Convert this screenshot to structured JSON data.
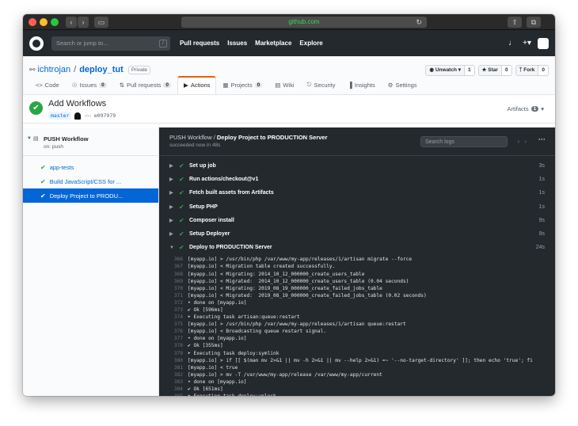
{
  "browser": {
    "url": "github.com",
    "reload_icon": "reload-icon"
  },
  "header": {
    "search_placeholder": "Search or jump to...",
    "search_shortcut": "/",
    "nav": [
      "Pull requests",
      "Issues",
      "Marketplace",
      "Explore"
    ],
    "icons": [
      "bell-icon",
      "plus-icon",
      "avatar-icon"
    ]
  },
  "repo": {
    "owner": "ichtrojan",
    "separator": "/",
    "name": "deploy_tut",
    "visibility": "Private",
    "watch_label": "Unwatch",
    "watch_count": "1",
    "star_label": "Star",
    "star_count": "0",
    "fork_label": "Fork",
    "fork_count": "0"
  },
  "tabs": [
    {
      "label": "Code",
      "icon": "code-icon",
      "count": null
    },
    {
      "label": "Issues",
      "icon": "issue-icon",
      "count": "0"
    },
    {
      "label": "Pull requests",
      "icon": "pr-icon",
      "count": "0"
    },
    {
      "label": "Actions",
      "icon": "play-icon",
      "count": null,
      "active": true
    },
    {
      "label": "Projects",
      "icon": "project-icon",
      "count": "0"
    },
    {
      "label": "Wiki",
      "icon": "book-icon",
      "count": null
    },
    {
      "label": "Security",
      "icon": "shield-icon",
      "count": null
    },
    {
      "label": "Insights",
      "icon": "graph-icon",
      "count": null
    },
    {
      "label": "Settings",
      "icon": "gear-icon",
      "count": null
    }
  ],
  "run": {
    "title": "Add Workflows",
    "branch": "master",
    "commit": "e097979",
    "artifacts_label": "Artifacts",
    "artifacts_count": "1"
  },
  "sidebar": {
    "workflow_name": "PUSH Workflow",
    "workflow_trigger": "on: push",
    "jobs": [
      {
        "label": "app-tests",
        "active": false
      },
      {
        "label": "Build JavaScript/CSS for ...",
        "active": false
      },
      {
        "label": "Deploy Project to PRODU...",
        "active": true
      }
    ]
  },
  "console": {
    "workflow": "PUSH Workflow",
    "separator": " / ",
    "job": "Deploy Project to PRODUCTION Server",
    "status": "succeeded now in 48s",
    "search_placeholder": "Search logs",
    "more": "···",
    "steps": [
      {
        "label": "Set up job",
        "duration": "3s",
        "expanded": false
      },
      {
        "label": "Run actions/checkout@v1",
        "duration": "1s",
        "expanded": false
      },
      {
        "label": "Fetch built assets from Artifacts",
        "duration": "1s",
        "expanded": false
      },
      {
        "label": "Setup PHP",
        "duration": "1s",
        "expanded": false
      },
      {
        "label": "Composer install",
        "duration": "9s",
        "expanded": false
      },
      {
        "label": "Setup Deployer",
        "duration": "9s",
        "expanded": false
      },
      {
        "label": "Deploy to PRODUCTION Server",
        "duration": "24s",
        "expanded": true
      }
    ],
    "log": [
      {
        "n": "366",
        "t": "[myapp.io] > /usr/bin/php /var/www/my-app/releases/1/artisan migrate --force"
      },
      {
        "n": "367",
        "t": "[myapp.io] < Migration table created successfully."
      },
      {
        "n": "368",
        "t": "[myapp.io] < Migrating: 2014_10_12_000000_create_users_table"
      },
      {
        "n": "369",
        "t": "[myapp.io] < Migrated:  2014_10_12_000000_create_users_table (0.04 seconds)"
      },
      {
        "n": "370",
        "t": "[myapp.io] < Migrating: 2019_08_19_000000_create_failed_jobs_table"
      },
      {
        "n": "371",
        "t": "[myapp.io] < Migrated:  2019_08_19_000000_create_failed_jobs_table (0.02 seconds)"
      },
      {
        "n": "372",
        "t": "• done on [myapp.io]"
      },
      {
        "n": "373",
        "t": "✔ Ok [596ms]"
      },
      {
        "n": "374",
        "t": "➤ Executing task artisan:queue:restart"
      },
      {
        "n": "375",
        "t": "[myapp.io] > /usr/bin/php /var/www/my-app/releases/1/artisan queue:restart"
      },
      {
        "n": "376",
        "t": "[myapp.io] < Broadcasting queue restart signal."
      },
      {
        "n": "377",
        "t": "• done on [myapp.io]"
      },
      {
        "n": "378",
        "t": "✔ Ok [355ms]"
      },
      {
        "n": "379",
        "t": "➤ Executing task deploy:symlink"
      },
      {
        "n": "380",
        "t": "[myapp.io] > if [[ $(man mv 2>&1 || mv -h 2>&1 || mv --help 2>&1) =~ '--no-target-directory' ]]; then echo 'true'; fi"
      },
      {
        "n": "381",
        "t": "[myapp.io] < true"
      },
      {
        "n": "382",
        "t": "[myapp.io] > mv -T /var/www/my-app/release /var/www/my-app/current"
      },
      {
        "n": "383",
        "t": "• done on [myapp.io]"
      },
      {
        "n": "384",
        "t": "✔ Ok [651ms]"
      },
      {
        "n": "385",
        "t": "➤ Executing task deploy:unlock"
      }
    ]
  }
}
